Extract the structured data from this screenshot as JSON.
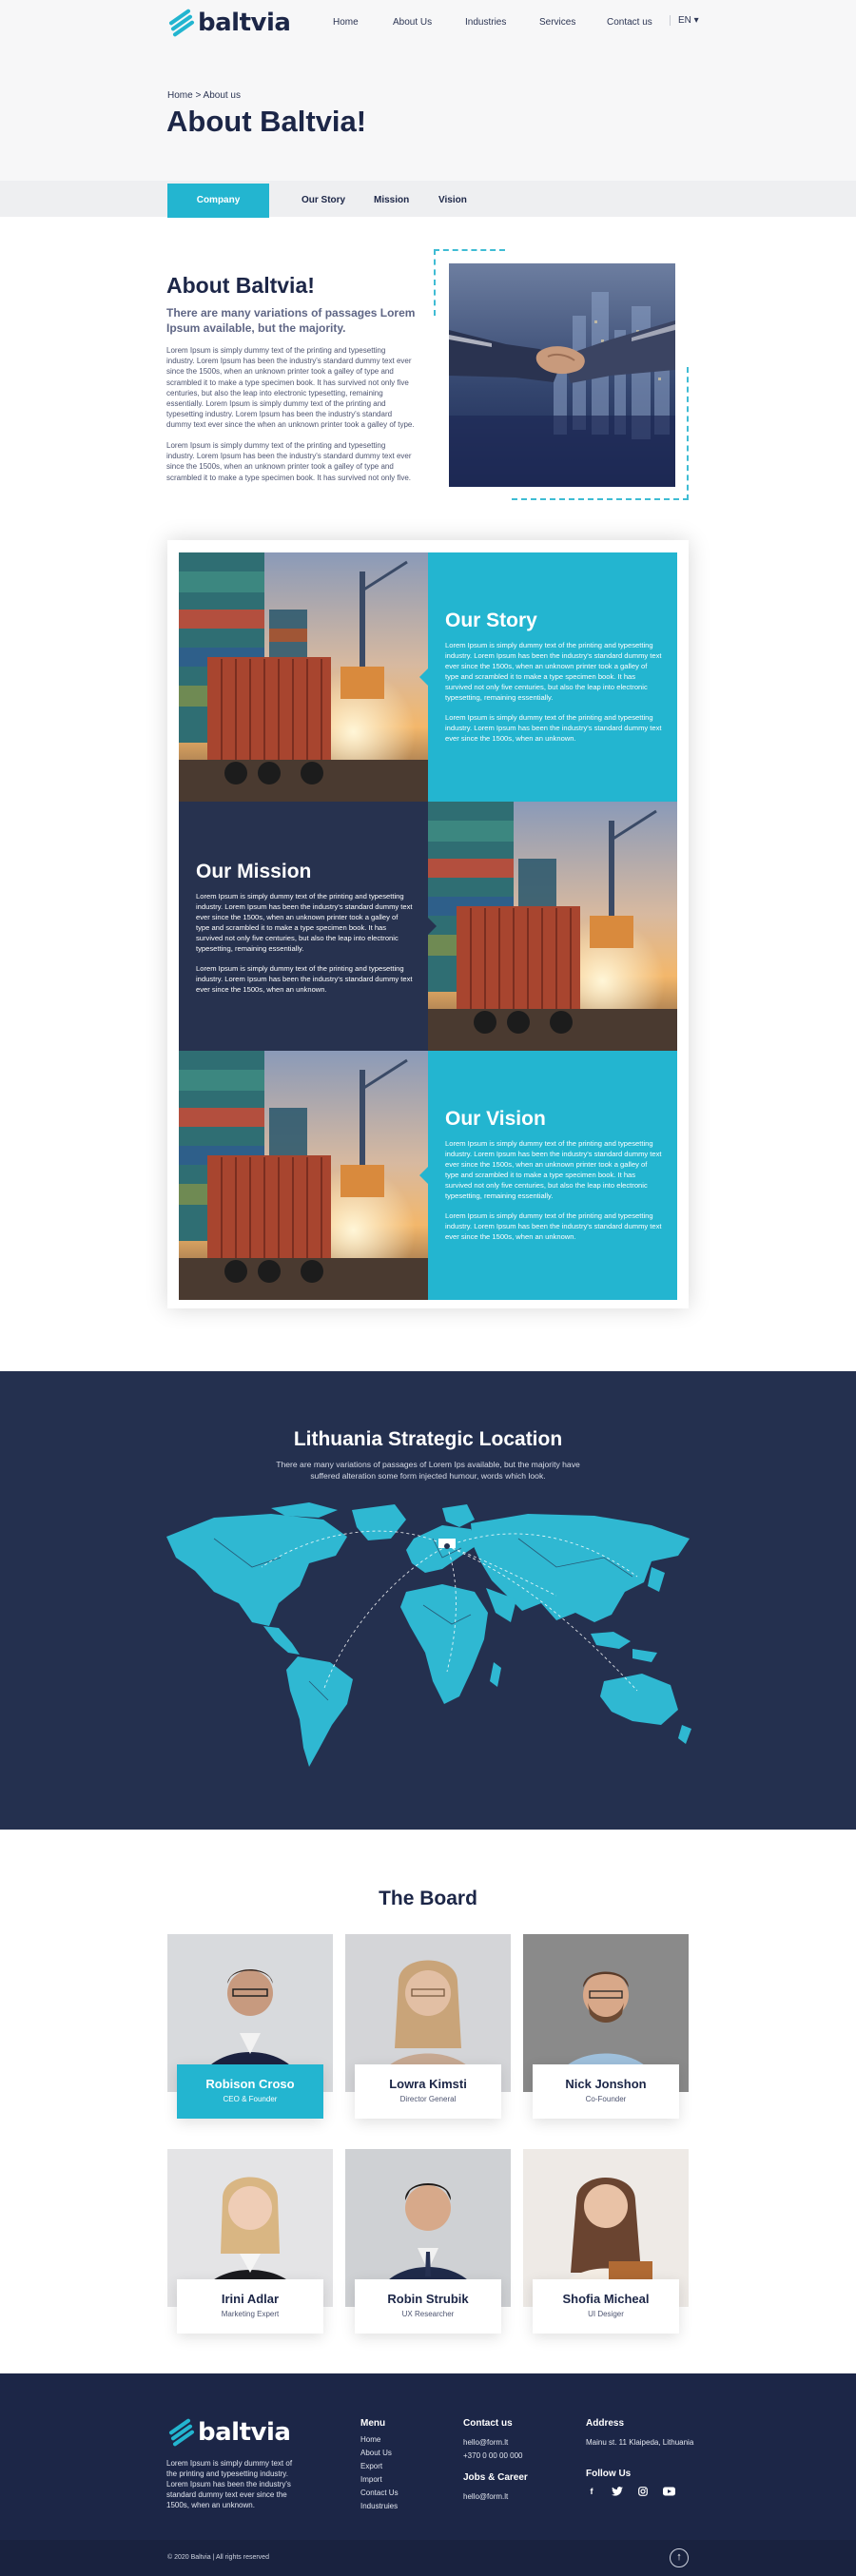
{
  "header": {
    "logo_text": "baltvia",
    "nav": [
      "Home",
      "About Us",
      "Industries",
      "Services",
      "Contact us"
    ],
    "lang": "EN ▾"
  },
  "hero": {
    "breadcrumb": "Home > About us",
    "title": "About Baltvia!"
  },
  "tabs": [
    "Company",
    "Our Story",
    "Mission",
    "Vision"
  ],
  "about": {
    "heading": "About Baltvia!",
    "subheading": "There are many variations of passages Lorem Ipsum available, but the majority.",
    "p1": "Lorem Ipsum is simply dummy text of the printing and typesetting industry. Lorem Ipsum has been the industry's standard dummy text ever since the 1500s, when an unknown printer took a galley of type and scrambled it to make a type specimen book. It has survived not only five centuries, but also the leap into electronic typesetting, remaining essentially. Lorem Ipsum is simply dummy text of the printing and typesetting industry. Lorem Ipsum has been the industry's standard dummy text ever since the  when an unknown printer took a galley of type.",
    "p2": "Lorem Ipsum is simply dummy text of the printing and typesetting industry. Lorem Ipsum has been the industry's standard dummy text ever since the 1500s, when an unknown printer took a galley of type and scrambled it to make a type specimen book. It has survived not only five."
  },
  "stories": {
    "story": {
      "title": "Our Story",
      "p1": "Lorem Ipsum is simply dummy text of the printing and typesetting industry. Lorem Ipsum has been the industry's standard dummy text ever since the 1500s, when an unknown printer took a galley of type and scrambled it to make a type specimen book. It has survived not only five centuries, but also the leap into electronic typesetting, remaining essentially.",
      "p2": "Lorem Ipsum is simply dummy text of the printing and typesetting industry. Lorem Ipsum has been the industry's standard dummy text ever since the 1500s, when an unknown."
    },
    "mission": {
      "title": "Our Mission",
      "p1": "Lorem Ipsum is simply dummy text of the printing and typesetting industry. Lorem Ipsum has been the industry's standard dummy text ever since the 1500s, when an unknown printer took a galley of type and scrambled it to make a type specimen book. It has survived not only five centuries, but also the leap into electronic typesetting, remaining essentially.",
      "p2": "Lorem Ipsum is simply dummy text of the printing and typesetting industry. Lorem Ipsum has been the industry's standard dummy text ever since the 1500s, when an unknown."
    },
    "vision": {
      "title": "Our Vision",
      "p1": "Lorem Ipsum is simply dummy text of the printing and typesetting industry. Lorem Ipsum has been the industry's standard dummy text ever since the 1500s, when an unknown printer took a galley of type and scrambled it to make a type specimen book. It has survived not only five centuries, but also the leap into electronic typesetting, remaining essentially.",
      "p2": "Lorem Ipsum is simply dummy text of the printing and typesetting industry. Lorem Ipsum has been the industry's standard dummy text ever since the 1500s, when an unknown."
    }
  },
  "location": {
    "title": "Lithuania Strategic Location",
    "subtitle": "There are many variations of passages of Lorem Ips available, but the majority have suffered alteration some form injected humour, words which look."
  },
  "board": {
    "title": "The Board",
    "members": [
      {
        "name": "Robison Croso",
        "role": "CEO & Founder"
      },
      {
        "name": "Lowra Kimsti",
        "role": "Director General"
      },
      {
        "name": "Nick Jonshon",
        "role": "Co-Founder"
      },
      {
        "name": "Irini Adlar",
        "role": "Marketing Expert"
      },
      {
        "name": "Robin Strubik",
        "role": "UX Researcher"
      },
      {
        "name": "Shofia Micheal",
        "role": "UI Desiger"
      }
    ]
  },
  "footer": {
    "logo_text": "baltvia",
    "about": "Lorem Ipsum is simply dummy text of the printing and typesetting industry. Lorem Ipsum has been the industry's standard dummy text ever since the 1500s, when an unknown.",
    "menu_title": "Menu",
    "menu": [
      "Home",
      "About Us",
      "Export",
      "Import",
      "Contact Us",
      "Industruies"
    ],
    "contact_title": "Contact us",
    "contact_email": "hello@form.lt",
    "contact_phone": "+370 0 00 00 000",
    "jobs_title": "Jobs & Career",
    "jobs_email": "hello@form.lt",
    "address_title": "Address",
    "address": "Mainu st. 11 Klaipeda, Lithuania",
    "follow_title": "Follow Us",
    "social": [
      "facebook-icon",
      "twitter-icon",
      "instagram-icon",
      "youtube-icon"
    ],
    "copyright": "© 2020 Baltvia | All rights reserved"
  },
  "colors": {
    "accent": "#23b5d0",
    "navy": "#24304f",
    "footer": "#1c2647"
  }
}
